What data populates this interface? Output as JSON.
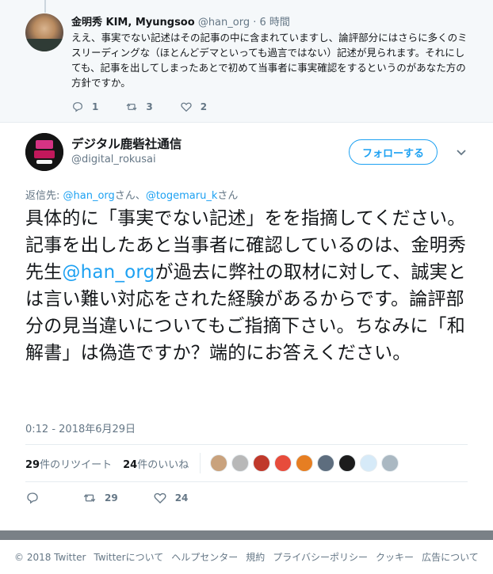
{
  "reply_tweet": {
    "name": "金明秀 KIM, Myungsoo",
    "handle": "@han_org",
    "separator": "·",
    "time": "6 時間",
    "text": "ええ、事実でない記述はその記事の中に含まれていますし、論評部分にはさらに多くのミスリーディングな（ほとんどデマといっても過言ではない）記述が見られます。それにしても、記事を出してしまったあとで初めて当事者に事実確認をするというのがあなた方の方針ですか。",
    "reply_count": "1",
    "retweet_count": "3",
    "like_count": "2"
  },
  "main_tweet": {
    "name": "デジタル鹿砦社通信",
    "handle": "@digital_rokusai",
    "follow_label": "フォローする",
    "reply_to_prefix": "返信先: ",
    "reply_to_mention1": "@han_org",
    "reply_to_san1": "さん、",
    "reply_to_mention2": "@togemaru_k",
    "reply_to_san2": "さん",
    "text_part1": "具体的に「事実でない記述」をを指摘してください。記事を出したあと当事者に確認しているのは、金明秀先生",
    "text_mention": "@han_org",
    "text_part2": "が過去に弊社の取材に対して、誠実とは言い難い対応をされた経験があるからです。論評部分の見当違いについてもご指摘下さい。ちなみに「和解書」は偽造ですか？端的にお答えください。",
    "timestamp": "0:12 - 2018年6月29日",
    "retweets_count": "29",
    "retweets_label": "件のリツイート",
    "likes_count": "24",
    "likes_label": "件のいいね",
    "likers": [
      {
        "icon": "liker-avatar-1",
        "color": "#c9a27d"
      },
      {
        "icon": "liker-avatar-2",
        "color": "#b8b8b8"
      },
      {
        "icon": "liker-avatar-3",
        "color": "#c0392b"
      },
      {
        "icon": "liker-avatar-4",
        "color": "#e74c3c"
      },
      {
        "icon": "liker-avatar-5",
        "color": "#e67e22"
      },
      {
        "icon": "liker-avatar-6",
        "color": "#5d6d7e"
      },
      {
        "icon": "liker-avatar-7",
        "color": "#1c1c1c"
      },
      {
        "icon": "liker-avatar-8",
        "color": "#d6eaf8"
      },
      {
        "icon": "liker-avatar-9",
        "color": "#aab8c2"
      }
    ],
    "action_reply_count": "",
    "action_retweet_count": "29",
    "action_like_count": "24"
  },
  "footer": {
    "items": [
      "© 2018 Twitter",
      "Twitterについて",
      "ヘルプセンター",
      "規約",
      "プライバシーポリシー",
      "クッキー",
      "広告について"
    ]
  },
  "colors": {
    "accent": "#1da1f2",
    "muted": "#657786",
    "reply_background": "#f5f8fa"
  }
}
